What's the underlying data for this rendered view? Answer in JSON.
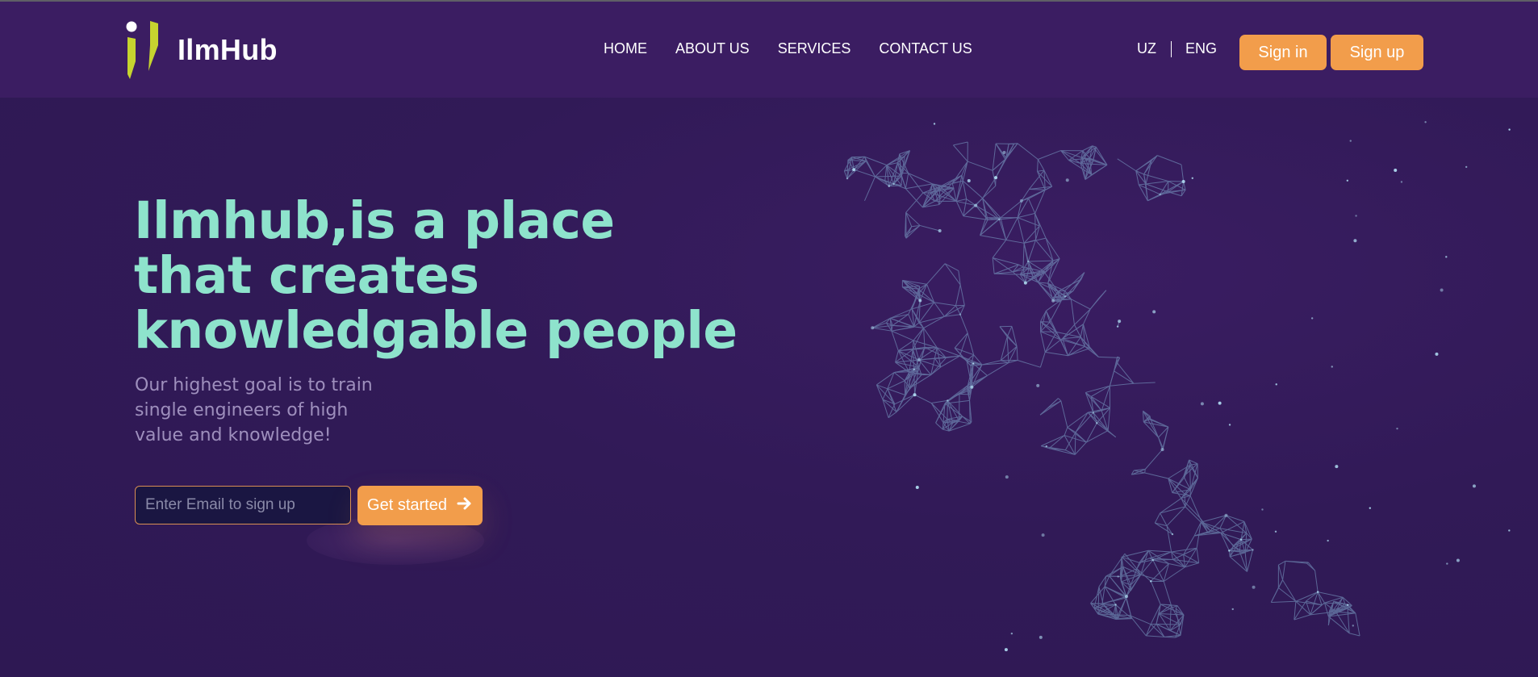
{
  "brand": {
    "name": "IlmHub"
  },
  "nav": {
    "items": [
      {
        "label": "HOME"
      },
      {
        "label": "ABOUT US"
      },
      {
        "label": "SERVICES"
      },
      {
        "label": "CONTACT US"
      }
    ]
  },
  "language": {
    "uz": "UZ",
    "eng": "ENG"
  },
  "auth": {
    "sign_in": "Sign in",
    "sign_up": "Sign up"
  },
  "hero": {
    "title": "Ilmhub,is a place that creates knowledgable people",
    "subtitle": "Our highest goal is to train single engineers of high value and knowledge!",
    "email_placeholder": "Enter Email to sign up",
    "cta": "Get started"
  },
  "colors": {
    "background": "#351b5a",
    "header": "#3b1d62",
    "accent": "#f29d4b",
    "title": "#8ee3cc",
    "subtitle": "#9e8fbd",
    "logo_mark": "#c6d42f"
  },
  "icons": {
    "logo": "ilmhub-logo-icon",
    "cta_arrow": "arrow-right-icon",
    "illustration": "polygon-runner-illustration"
  }
}
